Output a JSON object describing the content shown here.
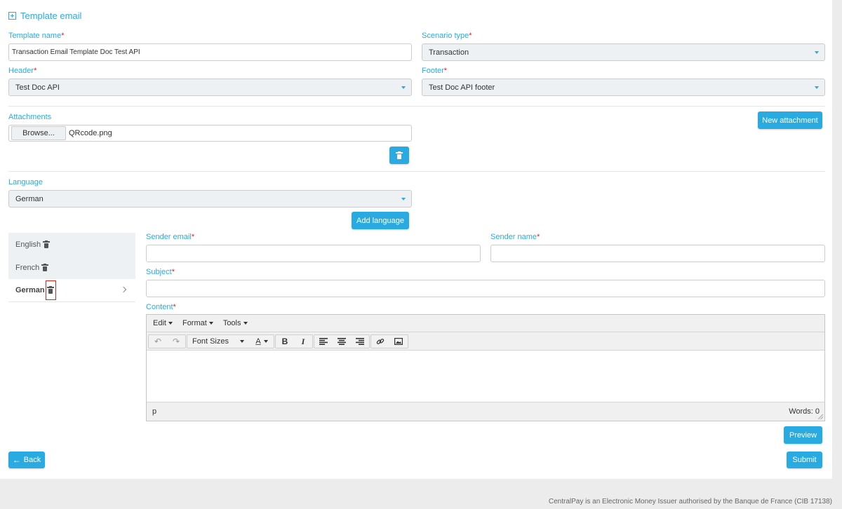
{
  "section_title": "Template email",
  "required_mark": "*",
  "template_name": {
    "label": "Template name",
    "value": "Transaction Email Template Doc Test API"
  },
  "scenario_type": {
    "label": "Scenario type",
    "value": "Transaction"
  },
  "header": {
    "label": "Header",
    "value": "Test Doc API"
  },
  "footer_field": {
    "label": "Footer",
    "value": "Test Doc API footer"
  },
  "attachments": {
    "label": "Attachments",
    "browse_label": "Browse...",
    "file_name": "QRcode.png",
    "new_button": "New attachment"
  },
  "language": {
    "label": "Language",
    "value": "German",
    "add_button": "Add language"
  },
  "language_tabs": [
    {
      "label": "English"
    },
    {
      "label": "French"
    },
    {
      "label": "German"
    }
  ],
  "sender_email": {
    "label": "Sender email",
    "value": ""
  },
  "sender_name": {
    "label": "Sender name",
    "value": ""
  },
  "subject": {
    "label": "Subject",
    "value": ""
  },
  "content": {
    "label": "Content",
    "menus": [
      "Edit",
      "Format",
      "Tools"
    ],
    "font_sizes_label": "Font Sizes",
    "font_color_label": "A",
    "bold_label": "B",
    "italic_label": "I",
    "status_path": "p",
    "word_count": "Words: 0"
  },
  "buttons": {
    "preview": "Preview",
    "back": "Back",
    "submit": "Submit"
  },
  "footer_text": "CentralPay is an Electronic Money Issuer authorised by the Banque de France (CIB 17138)",
  "colors": {
    "accent": "#29abe2",
    "required": "#e02020",
    "highlight": "#e02020"
  }
}
